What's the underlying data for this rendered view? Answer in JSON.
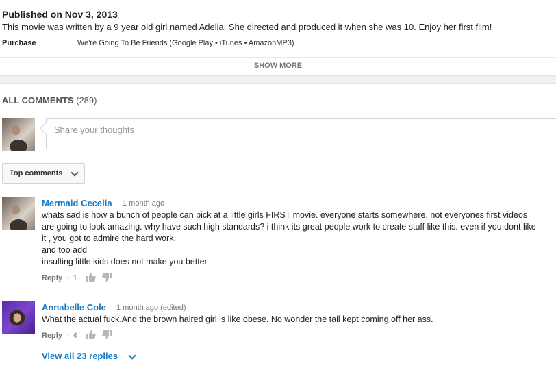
{
  "description": {
    "published": "Published on Nov 3, 2013",
    "text": "This movie was written by a 9 year old girl named Adelia. She directed and produced it when she was 10. Enjoy her first film!",
    "purchase_label": "Purchase",
    "purchase_value": "We're Going To Be Friends (Google Play • iTunes • AmazonMP3)",
    "show_more": "SHOW MORE"
  },
  "comments_header": {
    "label": "ALL COMMENTS",
    "count": "(289)"
  },
  "share_box": {
    "placeholder": "Share your thoughts"
  },
  "sort": {
    "selected": "Top comments"
  },
  "comments": [
    {
      "author": "Mermaid Cecelia",
      "time": "1 month ago",
      "lines": [
        "whats sad is how a bunch of people can pick at a little girls FIRST movie. everyone starts somewhere. not everyones first videos",
        "are going to look amazing. why have such high standards? i think its great people work to create stuff like this. even if you dont like",
        "it , you got to admire the hard work.",
        "and too add",
        "insulting little kids does not make you better"
      ],
      "reply_label": "Reply",
      "likes": "1"
    },
    {
      "author": "Annabelle Cole",
      "time": "1 month ago (edited)",
      "lines": [
        "What the actual fuck.And the brown haired girl is like obese. No wonder the tail kept coming off her ass."
      ],
      "reply_label": "Reply",
      "likes": "4"
    }
  ],
  "view_replies": "View all 23 replies",
  "colors": {
    "link_blue": "#167ac6",
    "muted_gray": "#767676",
    "border_gray": "#d3d3d3"
  },
  "icons": [
    "thumbs-up-icon",
    "thumbs-down-icon",
    "chevron-down-icon"
  ]
}
